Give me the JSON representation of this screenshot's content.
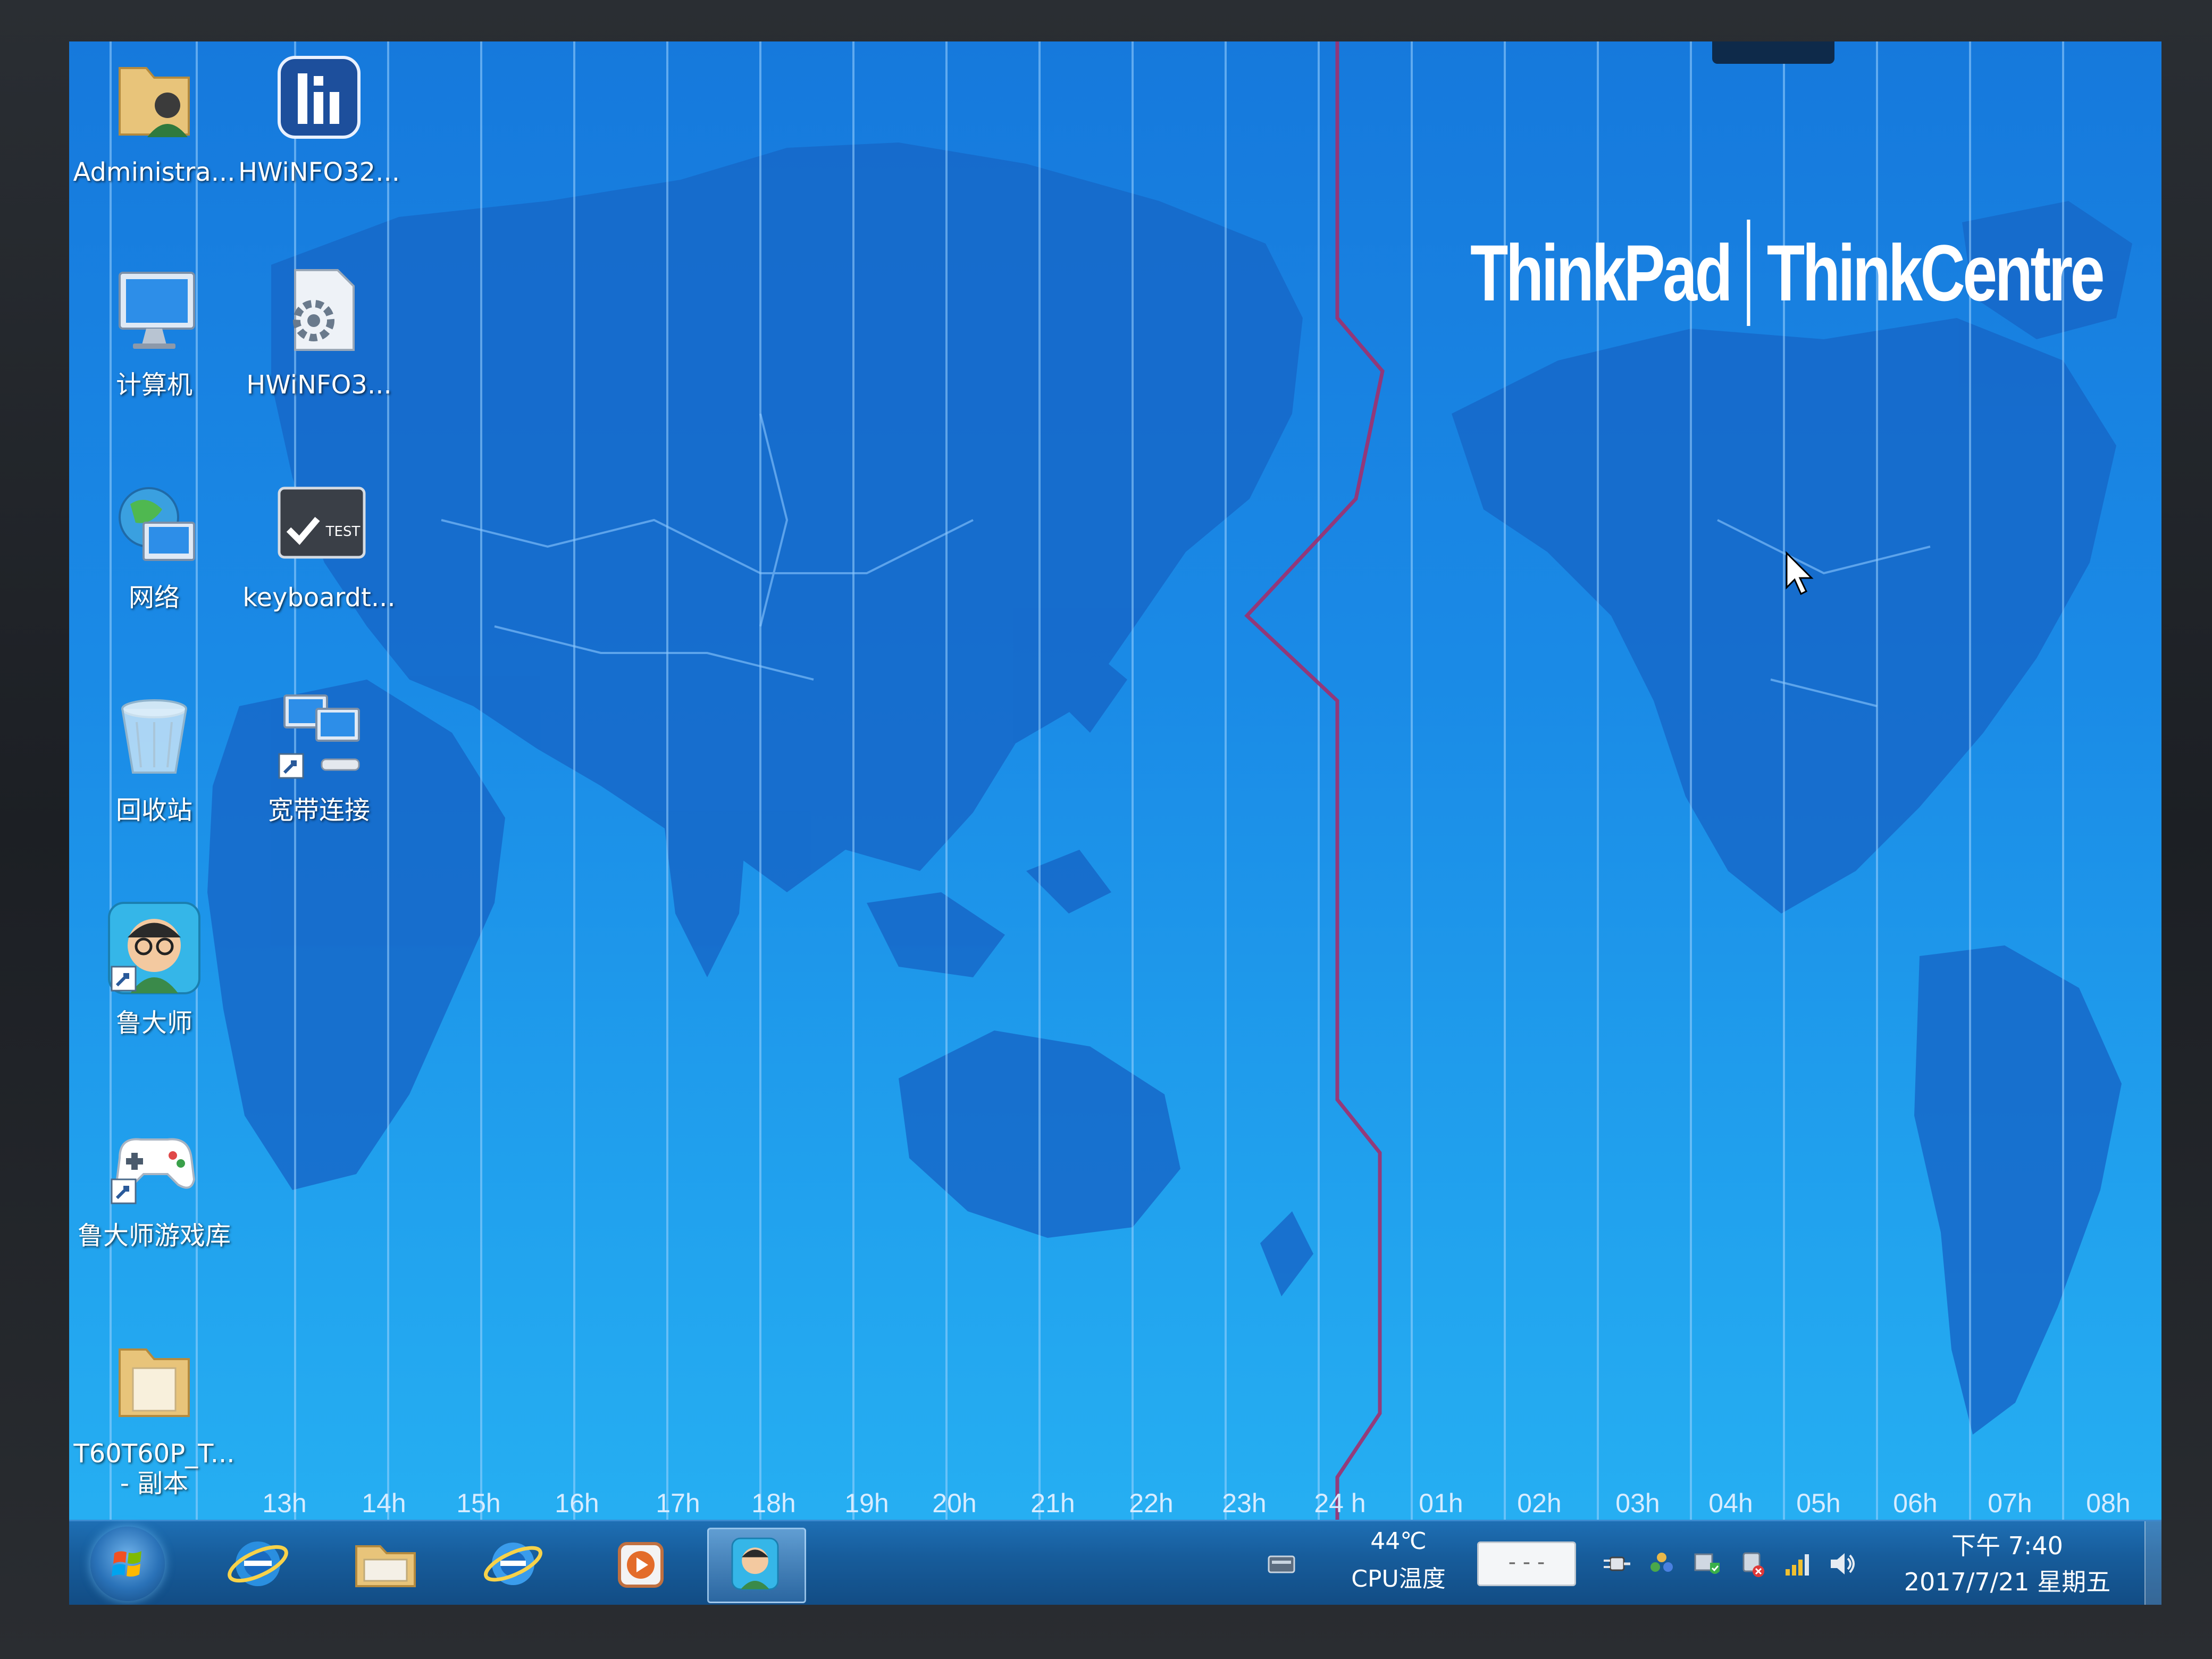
{
  "brand": {
    "left": "ThinkPad",
    "right": "ThinkCentre"
  },
  "desktop_icons": [
    {
      "label": "Administra...",
      "icon": "user-folder-icon"
    },
    {
      "label": "HWiNFO32...",
      "icon": "hwinfo-icon"
    },
    {
      "label": "计算机",
      "icon": "computer-icon"
    },
    {
      "label": "HWiNFO3...",
      "icon": "settings-file-icon"
    },
    {
      "label": "网络",
      "icon": "network-icon"
    },
    {
      "label": "keyboardt...",
      "icon": "keyboard-test-icon",
      "badge": "TEST"
    },
    {
      "label": "回收站",
      "icon": "recycle-bin-icon"
    },
    {
      "label": "宽带连接",
      "icon": "broadband-connection-icon"
    },
    {
      "label": "鲁大师",
      "icon": "ludashi-icon"
    },
    {
      "label": "鲁大师游戏库",
      "icon": "game-library-icon"
    },
    {
      "label": "T60T60P_T...",
      "label2": "- 副本",
      "icon": "folder-icon"
    }
  ],
  "hours": [
    "13h",
    "14h",
    "15h",
    "16h",
    "17h",
    "18h",
    "19h",
    "20h",
    "21h",
    "22h",
    "23h",
    "24 h",
    "01h",
    "02h",
    "03h",
    "04h",
    "05h",
    "06h",
    "07h",
    "08h"
  ],
  "taskbar": {
    "pinned": [
      "ie-icon",
      "file-explorer-icon",
      "ie-icon",
      "media-player-icon",
      "ludashi-icon"
    ],
    "cpu_temp": "44℃",
    "cpu_label": "CPU温度",
    "ime_text": "- - -",
    "time": "下午 7:40",
    "date": "2017/7/21 星期五"
  }
}
